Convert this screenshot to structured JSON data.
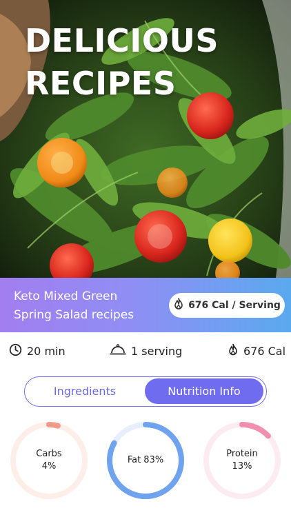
{
  "hero": {
    "title_line1": "DELICIOUS",
    "title_line2": "RECIPES"
  },
  "banner": {
    "title_line1": "Keto Mixed Green",
    "title_line2": "Spring Salad recipes",
    "calories_badge": "676 Cal / Serving",
    "badge_icon": "flame-icon"
  },
  "meta": {
    "time": "20 min",
    "time_icon": "clock-icon",
    "servings": "1 serving",
    "servings_icon": "cloche-icon",
    "calories": "676 Cal",
    "calories_icon": "flame-icon"
  },
  "tabs": [
    {
      "label": "Ingredients",
      "active": false
    },
    {
      "label": "Nutrition Info",
      "active": true
    }
  ],
  "nutrition": [
    {
      "name": "Carbs",
      "percent_label": "4%",
      "percent": 4,
      "color": "#f19a8a",
      "track": "#fdeeea"
    },
    {
      "name": "Fat",
      "percent_label": "Fat 83%",
      "percent": 83,
      "color": "#6fa3ee",
      "track": "#e8eefb"
    },
    {
      "name": "Protein",
      "percent_label": "13%",
      "percent": 13,
      "color": "#f08fae",
      "track": "#fcecf1"
    }
  ],
  "colors": {
    "accent": "#6f6cf0",
    "banner_start": "#a27ef0",
    "banner_end": "#5aa9ee"
  }
}
